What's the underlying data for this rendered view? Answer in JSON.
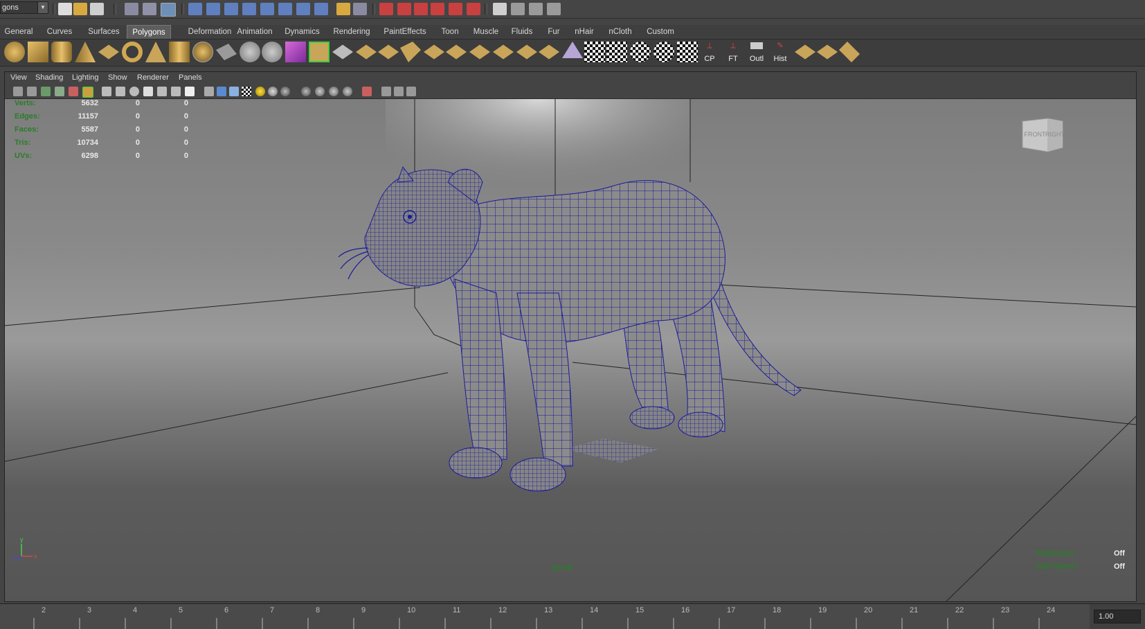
{
  "status_line": {
    "mode_value": "gons"
  },
  "shelf_tabs": [
    "General",
    "Curves",
    "Surfaces",
    "Polygons",
    "Deformation",
    "Animation",
    "Dynamics",
    "Rendering",
    "PaintEffects",
    "Toon",
    "Muscle",
    "Fluids",
    "Fur",
    "nHair",
    "nCloth",
    "Custom"
  ],
  "active_tab": "Polygons",
  "shelf_text_buttons": {
    "cp": "CP",
    "ft": "FT",
    "outl": "Outl",
    "hist": "Hist"
  },
  "panel_menu": [
    "View",
    "Shading",
    "Lighting",
    "Show",
    "Renderer",
    "Panels"
  ],
  "hud": {
    "rows": [
      {
        "label": "Verts:",
        "v1": "5632",
        "v2": "0",
        "v3": "0"
      },
      {
        "label": "Edges:",
        "v1": "11157",
        "v2": "0",
        "v3": "0"
      },
      {
        "label": "Faces:",
        "v1": "5587",
        "v2": "0",
        "v3": "0"
      },
      {
        "label": "Tris:",
        "v1": "10734",
        "v2": "0",
        "v3": "0"
      },
      {
        "label": "UVs:",
        "v1": "6298",
        "v2": "0",
        "v3": "0"
      }
    ],
    "camera": "persp",
    "reflection_label": "Reflection:",
    "reflection_value": "Off",
    "soft_select_label": "Soft Select:",
    "soft_select_value": "Off"
  },
  "viewcube": {
    "front": "FRONT",
    "right": "RIGHT"
  },
  "axis": {
    "x": "x",
    "y": "y",
    "z": "z"
  },
  "timeline": {
    "ticks": [
      "2",
      "3",
      "4",
      "5",
      "6",
      "7",
      "8",
      "9",
      "10",
      "11",
      "12",
      "13",
      "14",
      "15",
      "16",
      "17",
      "18",
      "19",
      "20",
      "21",
      "22",
      "23",
      "24"
    ],
    "current_frame": "1.00"
  },
  "colors": {
    "hud_label": "#2b7c2b",
    "wireframe": "#1a1a9a",
    "active_tab_bg": "#5d5d5d"
  }
}
